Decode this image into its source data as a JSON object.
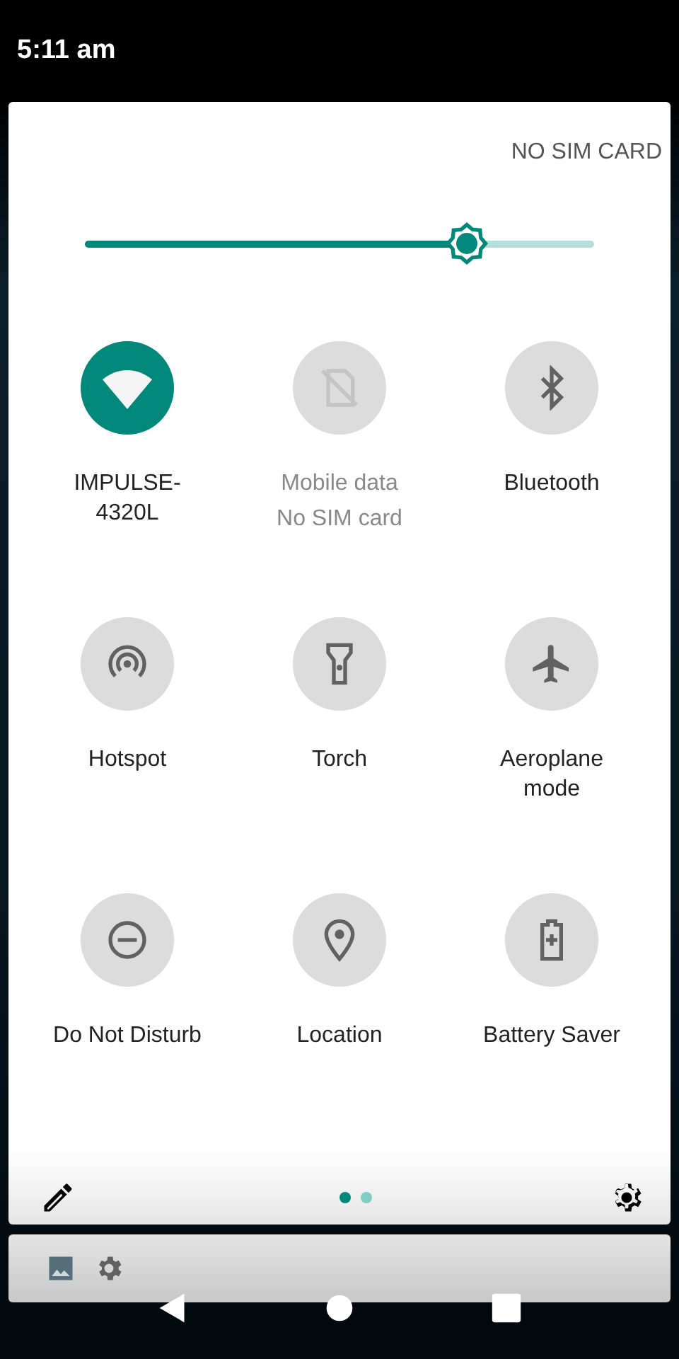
{
  "status_bar": {
    "time": "5:11 am"
  },
  "carrier": "NO SIM CARD",
  "brightness": {
    "level": 0.75
  },
  "tiles": [
    {
      "kind": "wifi",
      "label": "IMPULSE-4320L",
      "on": true,
      "disabled": false
    },
    {
      "kind": "mobile",
      "label": "Mobile data",
      "sublabel": "No SIM card",
      "on": false,
      "disabled": true
    },
    {
      "kind": "bluetooth",
      "label": "Bluetooth",
      "on": false,
      "disabled": false
    },
    {
      "kind": "hotspot",
      "label": "Hotspot",
      "on": false,
      "disabled": false
    },
    {
      "kind": "torch",
      "label": "Torch",
      "on": false,
      "disabled": false
    },
    {
      "kind": "aeroplane",
      "label": "Aeroplane mode",
      "on": false,
      "disabled": false
    },
    {
      "kind": "dnd",
      "label": "Do Not Disturb",
      "on": false,
      "disabled": false
    },
    {
      "kind": "location",
      "label": "Location",
      "on": false,
      "disabled": false
    },
    {
      "kind": "battery",
      "label": "Battery Saver",
      "on": false,
      "disabled": false
    }
  ],
  "pages": [
    {
      "selected": true
    },
    {
      "selected": false
    }
  ]
}
